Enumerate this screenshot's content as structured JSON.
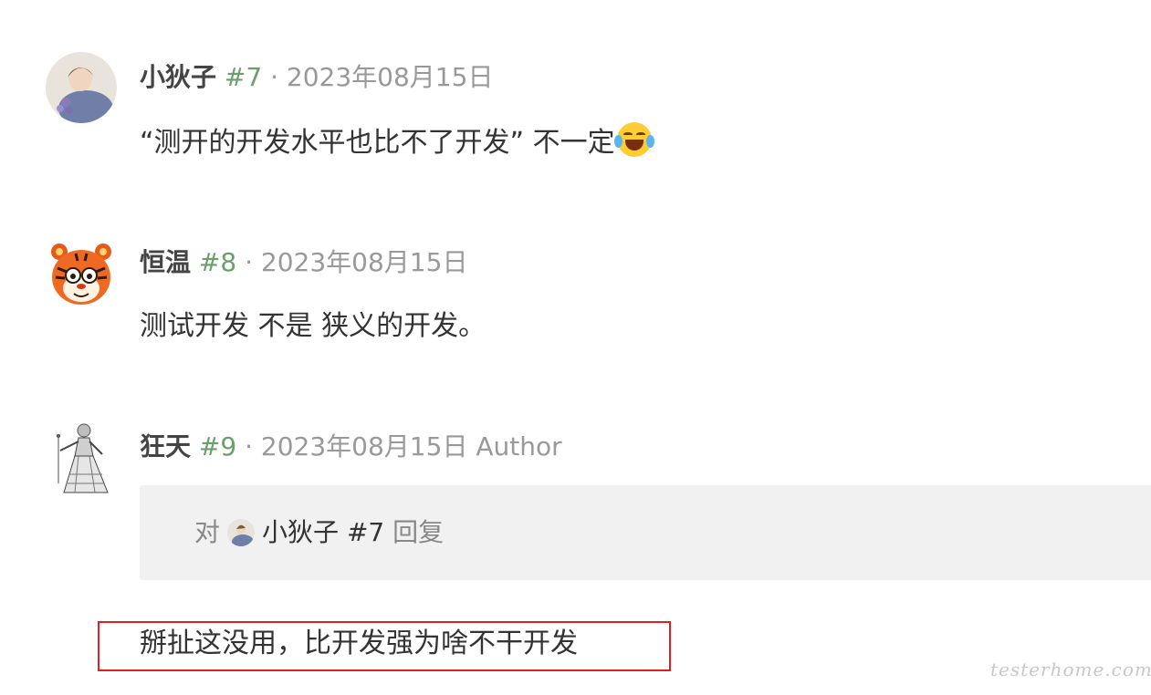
{
  "comments": [
    {
      "author": "小狄子",
      "floor": "#7",
      "separator": "·",
      "date": "2023年08月15日",
      "badge": "",
      "text": "“测开的开发水平也比不了开发” 不一定",
      "emoji_icon": "face-with-tears-of-joy-icon"
    },
    {
      "author": "恒温",
      "floor": "#8",
      "separator": "·",
      "date": "2023年08月15日",
      "badge": "",
      "text": "测试开发 不是 狭义的开发。"
    },
    {
      "author": "狂天",
      "floor": "#9",
      "separator": "·",
      "date": "2023年08月15日",
      "badge": "Author",
      "reply_to": {
        "prefix": "对",
        "user": "小狄子",
        "floor": "#7",
        "suffix": "回复"
      },
      "text": "掰扯这没用，比开发强为啥不干开发"
    }
  ],
  "watermark": "testerhome.com",
  "colors": {
    "floor": "#6a9f6a",
    "muted": "#999999",
    "highlight_border": "#e02020",
    "reply_bg": "#f1f1f1"
  }
}
